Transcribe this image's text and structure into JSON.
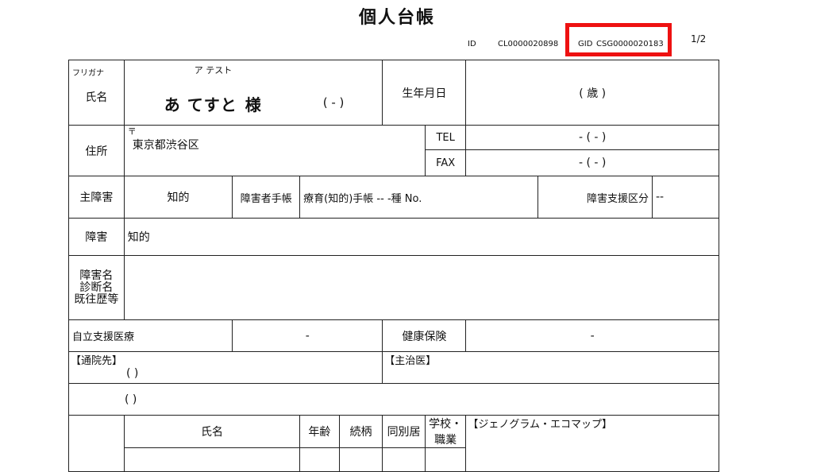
{
  "document": {
    "title": "個人台帳",
    "id_label": "ID",
    "id_value": "CL0000020898",
    "gid_label": "GID",
    "gid_value": "CSG0000020183",
    "page_indicator": "1/2",
    "highlight_color": "#ee1111"
  },
  "profile": {
    "furigana_label": "フリガナ",
    "furigana_value": "ア テスト",
    "name_label": "氏名",
    "name_value": "あ てすと",
    "honorific": "様",
    "name_paren": "(  -  )",
    "birth_label": "生年月日",
    "age_value": "(    歳  )"
  },
  "address": {
    "label": "住所",
    "zip_mark": "〒",
    "value": "東京都渋谷区",
    "tel_label": "TEL",
    "tel_value": "-  (  -  )",
    "fax_label": "FAX",
    "fax_value": "-  (  -  )"
  },
  "disability": {
    "main_label": "主障害",
    "main_value": "知的",
    "handbook_label": "障害者手帳",
    "handbook_value": "療育(知的)手帳  --  -種  No.",
    "support_class_label": "障害支援区分",
    "support_class_value": "--",
    "type_label": "障害",
    "type_value": "知的",
    "history_label_1": "障害名",
    "history_label_2": "診断名",
    "history_label_3": "既往歴等",
    "history_value": ""
  },
  "medical": {
    "support_label": "自立支援医療",
    "support_value": "-",
    "insurance_label": "健康保険",
    "insurance_value": "-",
    "hospital_label": "【通院先】",
    "hospital_row1": "(    )",
    "hospital_row2": "(    )",
    "doctor_label": "【主治医】"
  },
  "family": {
    "headers": [
      "氏名",
      "年齢",
      "続柄",
      "同別居",
      "学校・職業"
    ],
    "genogram_label": "【ジェノグラム・エコマップ】"
  }
}
